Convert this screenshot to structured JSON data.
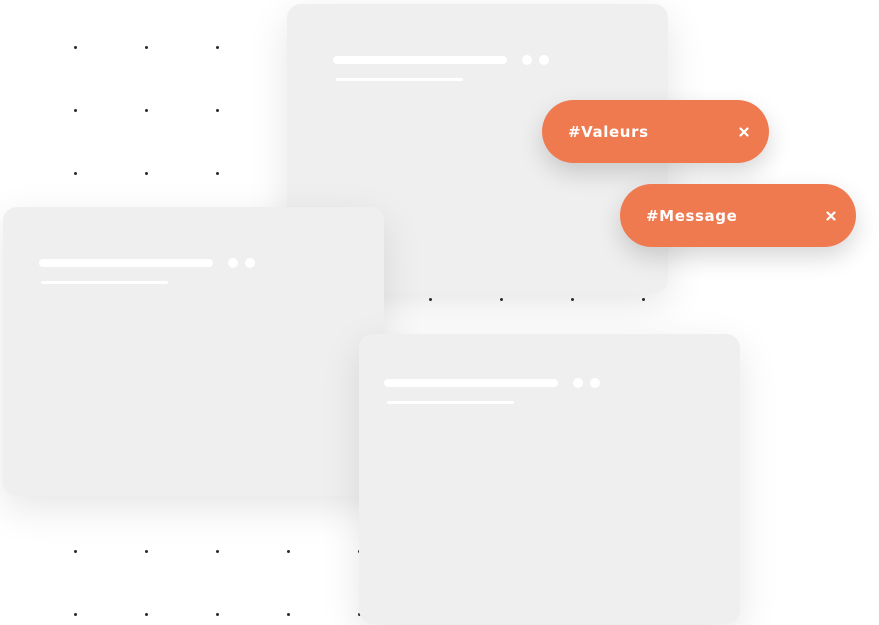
{
  "colors": {
    "tag_background": "#f07a50",
    "card_background": "#efefef",
    "dot": "#2b2b2b"
  },
  "tags": [
    {
      "label": "#Valeurs",
      "close_icon": "close-icon"
    },
    {
      "label": "#Message",
      "close_icon": "close-icon"
    }
  ],
  "cards": [
    {
      "name": "placeholder-card-top"
    },
    {
      "name": "placeholder-card-left"
    },
    {
      "name": "placeholder-card-bottom"
    }
  ]
}
